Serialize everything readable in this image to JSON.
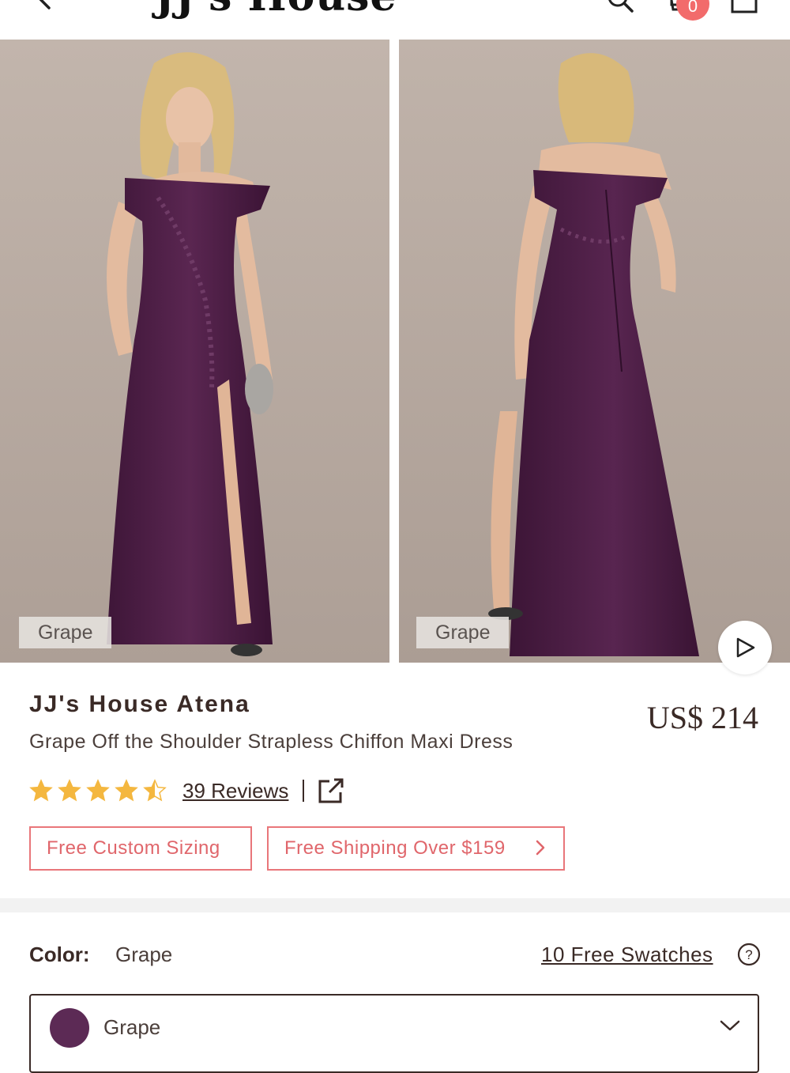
{
  "header": {
    "logo_text": "JJ's House",
    "cart_count": "0",
    "icons": [
      "chevron-left-icon",
      "search-icon",
      "cart-icon",
      "menu-icon"
    ]
  },
  "gallery": {
    "images": [
      {
        "view": "front",
        "color_tag": "Grape"
      },
      {
        "view": "back",
        "color_tag": "Grape"
      }
    ],
    "dress_color": "#4a1d42",
    "background_color": "#b8aba2",
    "play_icon": "play-icon"
  },
  "product": {
    "brand": "JJ's House Atena",
    "name": "Grape Off the Shoulder Strapless Chiffon Maxi Dress",
    "price": "US$ 214",
    "rating": 4.5,
    "rating_max": 5,
    "reviews_label": "39 Reviews",
    "star_color": "#f4b73f"
  },
  "promos": {
    "sizing": "Free Custom Sizing",
    "shipping": "Free Shipping Over $159",
    "accent_color": "#e9767a"
  },
  "color_section": {
    "label": "Color:",
    "value": "Grape",
    "swatches_link": "10 Free Swatches",
    "selected_option": "Grape",
    "swatch_color": "#5c2a55"
  }
}
